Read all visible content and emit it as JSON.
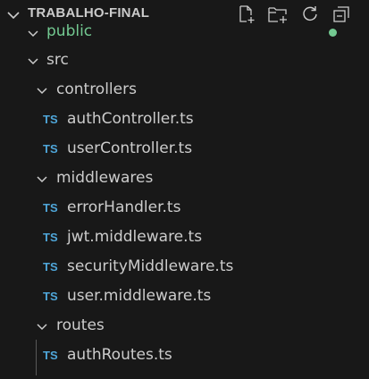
{
  "explorer": {
    "title": "TRABALHO-FINAL",
    "actions": [
      {
        "name": "new-file-icon",
        "label": "New File"
      },
      {
        "name": "new-folder-icon",
        "label": "New Folder"
      },
      {
        "name": "refresh-icon",
        "label": "Refresh Explorer"
      },
      {
        "name": "collapse-all-icon",
        "label": "Collapse Folders in Explorer"
      }
    ],
    "colors": {
      "background": "#181818",
      "text": "#cccccc",
      "ts_badge": "#4fa6d9",
      "git_untracked": "#73c991"
    }
  },
  "tree": {
    "public": {
      "label": "public",
      "expanded": true,
      "status": "untracked"
    },
    "src": {
      "label": "src",
      "expanded": true
    },
    "controllers": {
      "label": "controllers",
      "expanded": true
    },
    "authController": {
      "badge": "TS",
      "label": "authController.ts"
    },
    "userController": {
      "badge": "TS",
      "label": "userController.ts"
    },
    "middlewares": {
      "label": "middlewares",
      "expanded": true
    },
    "errorHandler": {
      "badge": "TS",
      "label": "errorHandler.ts"
    },
    "jwtMiddleware": {
      "badge": "TS",
      "label": "jwt.middleware.ts"
    },
    "securityMiddleware": {
      "badge": "TS",
      "label": "securityMiddleware.ts"
    },
    "userMiddleware": {
      "badge": "TS",
      "label": "user.middleware.ts"
    },
    "routes": {
      "label": "routes",
      "expanded": true
    },
    "authRoutes": {
      "badge": "TS",
      "label": "authRoutes.ts"
    }
  }
}
